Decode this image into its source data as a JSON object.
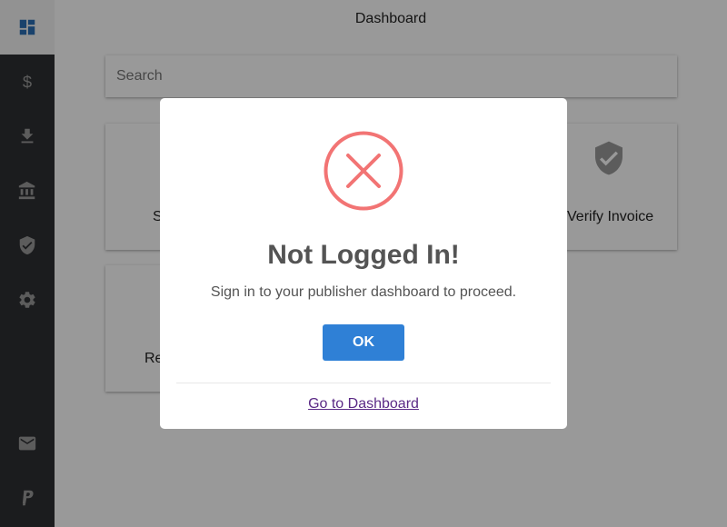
{
  "page": {
    "title": "Dashboard"
  },
  "search": {
    "placeholder": "Search"
  },
  "sidebar": {
    "items": [
      {
        "icon": "dashboard-icon",
        "active": true
      },
      {
        "icon": "dollar-icon"
      },
      {
        "icon": "download-icon"
      },
      {
        "icon": "bank-icon"
      },
      {
        "icon": "shield-check-icon"
      },
      {
        "icon": "gear-icon"
      },
      {
        "icon": "mail-icon"
      },
      {
        "icon": "paypal-icon"
      }
    ]
  },
  "cards": [
    {
      "label": "S",
      "icon": ""
    },
    {
      "label": "Verify Invoice",
      "icon": "shield-check-icon"
    },
    {
      "label": "Re",
      "icon": ""
    }
  ],
  "modal": {
    "icon": "error-x-icon",
    "title": "Not Logged In!",
    "text": "Sign in to your publisher dashboard to proceed.",
    "ok_label": "OK",
    "link_label": "Go to Dashboard"
  },
  "colors": {
    "accent": "#2f80d6",
    "error": "#f27474",
    "sidebar": "#2e2f32",
    "link": "#5b2a86"
  }
}
